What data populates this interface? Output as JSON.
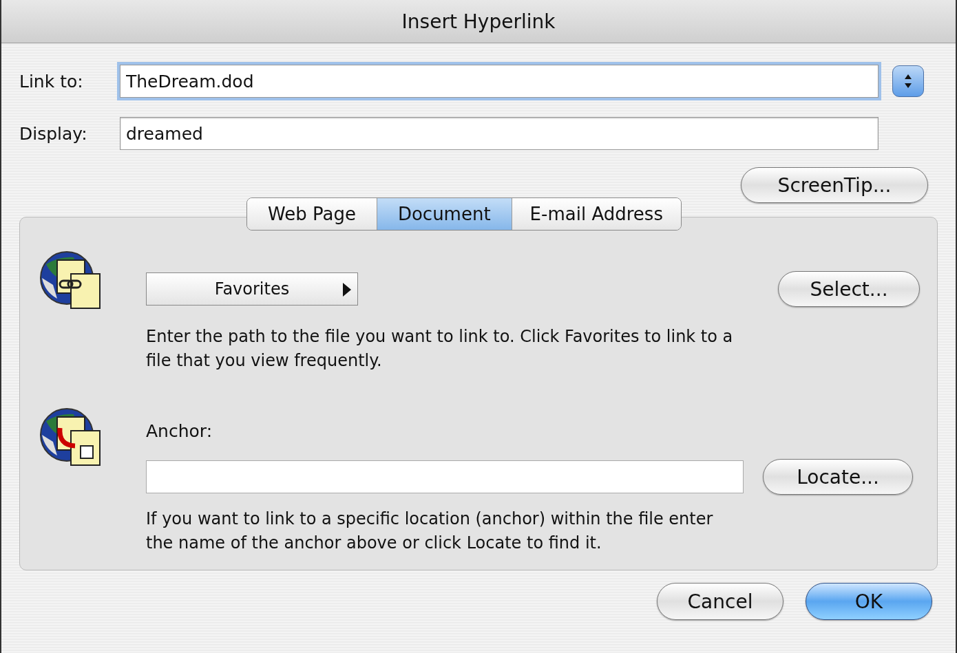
{
  "window": {
    "title": "Insert Hyperlink"
  },
  "fields": [
    {
      "label": "Link to:",
      "value": "TheDream.dod",
      "focused": true,
      "stepper": true
    },
    {
      "label": "Display:",
      "value": "dreamed",
      "focused": false,
      "stepper": false
    }
  ],
  "screentip_button": "ScreenTip...",
  "tabs": [
    {
      "label": "Web Page",
      "selected": false
    },
    {
      "label": "Document",
      "selected": true
    },
    {
      "label": "E-mail Address",
      "selected": false
    }
  ],
  "document_panel": {
    "favorites_popup": "Favorites",
    "select_button": "Select...",
    "path_help": "Enter the path to the file you want to link to. Click Favorites to link to a file that you view frequently.",
    "anchor_label": "Anchor:",
    "locate_button": "Locate...",
    "anchor_help": "If you want to link to a specific location (anchor) within the file enter the name of the anchor above or click Locate to find it."
  },
  "buttons": [
    {
      "label": "Cancel",
      "kind": "normal"
    },
    {
      "label": "OK",
      "kind": "default"
    }
  ]
}
